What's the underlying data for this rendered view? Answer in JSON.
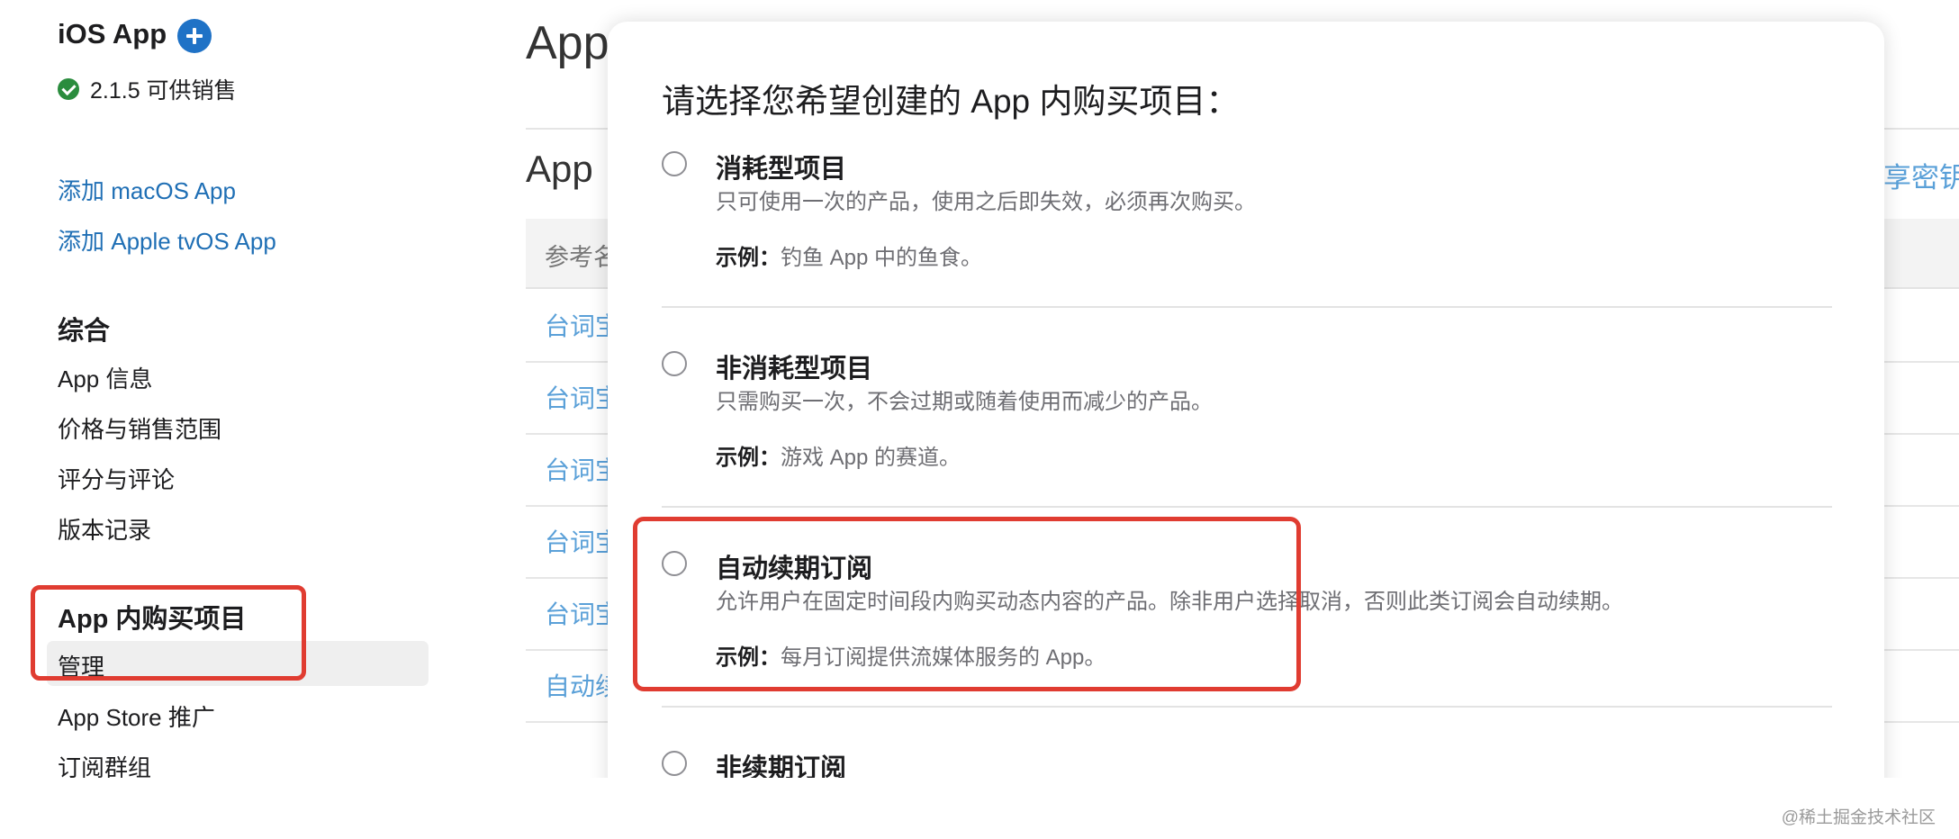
{
  "sidebar": {
    "app_title": "iOS App",
    "status": "2.1.5 可供销售",
    "links": [
      "添加 macOS App",
      "添加 Apple tvOS App"
    ],
    "general_heading": "综合",
    "general_items": [
      "App 信息",
      "价格与销售范围",
      "评分与评论",
      "版本记录"
    ],
    "iap_heading": "App 内购买项目",
    "iap_items": [
      "管理",
      "App Store 推广",
      "订阅群组"
    ]
  },
  "main": {
    "title": "App",
    "section_title": "App",
    "shared_secret": "享密钥",
    "table_header": "参考名",
    "rows": [
      "台词宝",
      "台词宝",
      "台词宝",
      "台词宝",
      "台词宝",
      "自动续"
    ]
  },
  "modal": {
    "title": "请选择您希望创建的 App 内购买项目：",
    "example_label": "示例：",
    "options": [
      {
        "title": "消耗型项目",
        "desc": "只可使用一次的产品，使用之后即失效，必须再次购买。",
        "example": "钓鱼 App 中的鱼食。"
      },
      {
        "title": "非消耗型项目",
        "desc": "只需购买一次，不会过期或随着使用而减少的产品。",
        "example": "游戏 App 的赛道。"
      },
      {
        "title": "自动续期订阅",
        "desc": "允许用户在固定时间段内购买动态内容的产品。除非用户选择取消，否则此类订阅会自动续期。",
        "example": "每月订阅提供流媒体服务的 App。"
      },
      {
        "title": "非续期订阅"
      }
    ]
  },
  "watermark": "@稀土掘金技术社区",
  "colors": {
    "link": "#1f6fb5",
    "accent": "#1f72c6",
    "success": "#2a8c3d",
    "annotation": "#e03c31"
  }
}
